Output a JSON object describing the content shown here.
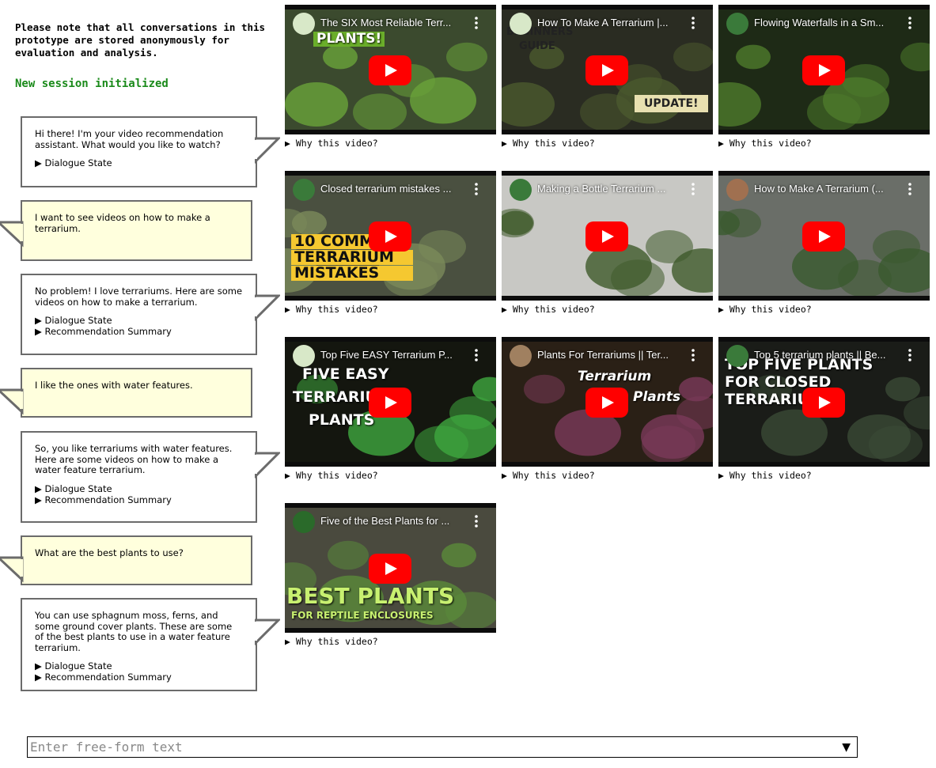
{
  "notice": "Please note that all conversations in this prototype are stored anonymously for evaluation and analysis.",
  "session_status": "New session initialized",
  "messages": [
    {
      "role": "bot",
      "text": "Hi there! I'm your video recommendation assistant. What would you like to watch?",
      "details": [
        "▶ Dialogue State"
      ]
    },
    {
      "role": "user",
      "text": "I want to see videos on how to make a terrarium.",
      "details": []
    },
    {
      "role": "bot",
      "text": "No problem! I love terrariums. Here are some videos on how to make a terrarium.",
      "details": [
        "▶ Dialogue State",
        "▶ Recommendation Summary"
      ]
    },
    {
      "role": "user",
      "text": "I like the ones with water features.",
      "details": []
    },
    {
      "role": "bot",
      "text": "So, you like terrariums with water features. Here are some videos on how to make a water feature terrarium.",
      "details": [
        "▶ Dialogue State",
        "▶ Recommendation Summary"
      ]
    },
    {
      "role": "user",
      "text": "What are the best plants to use?",
      "details": []
    },
    {
      "role": "bot",
      "text": "You can use sphagnum moss, ferns, and some ground cover plants. These are some of the best plants to use in a water feature terrarium.",
      "details": [
        "▶ Dialogue State",
        "▶ Recommendation Summary"
      ]
    }
  ],
  "why_label": "▶ Why this video?",
  "videos": [
    {
      "title": "The SIX Most Reliable Terr...",
      "overlay": [
        "PLANTS!"
      ],
      "bg": "#3b4a2e",
      "accent": "#6aa33a",
      "chan": "#d8e8c8"
    },
    {
      "title": "How To Make A Terrarium |...",
      "overlay": [
        "BEGINNERS",
        "GUIDE",
        "UPDATE!"
      ],
      "bg": "#2a2c22",
      "accent": "#4b5a2e",
      "chan": "#d8e8c8"
    },
    {
      "title": "Flowing Waterfalls in a Sm...",
      "overlay": [],
      "bg": "#1e2a16",
      "accent": "#4d7a2c",
      "chan": "#3a7a3a"
    },
    {
      "title": "Closed terrarium mistakes ...",
      "overlay": [
        "10 COMM",
        "TERRARIUM",
        "MISTAKES"
      ],
      "bg": "#4a5040",
      "accent": "#7a8a5a",
      "chan": "#3a7a3a"
    },
    {
      "title": "Making a Bottle Terrarium ...",
      "overlay": [],
      "bg": "#c8c8c4",
      "accent": "#3e5a2a",
      "chan": "#3a7a3a"
    },
    {
      "title": "How to Make A Terrarium (...",
      "overlay": [],
      "bg": "#6a6e68",
      "accent": "#3a5a2e",
      "chan": "#a07050"
    },
    {
      "title": "Top Five EASY Terrarium P...",
      "overlay": [
        "FIVE EASY",
        "TERRARIUM",
        "PLANTS"
      ],
      "bg": "#14160f",
      "accent": "#3ea83e",
      "chan": "#d8e8c8"
    },
    {
      "title": "Plants For Terrariums || Ter...",
      "overlay": [
        "Terrarium",
        "Plants"
      ],
      "bg": "#2a2016",
      "accent": "#7a3a5a",
      "chan": "#a08060"
    },
    {
      "title": "Top 5 terrarium plants || Be...",
      "overlay": [
        "TOP FIVE PLANTS",
        "FOR CLOSED",
        "TERRARIUMS"
      ],
      "bg": "#1a1c18",
      "accent": "#3a4a36",
      "chan": "#3a7a3a"
    },
    {
      "title": "Five of the Best Plants for ...",
      "overlay": [
        "BEST PLANTS",
        "FOR REPTILE ENCLOSURES"
      ],
      "bg": "#4a4a3e",
      "accent": "#5a8a3a",
      "chan": "#2a6a2a"
    }
  ],
  "input": {
    "placeholder": "Enter free-form text",
    "value": ""
  },
  "dropdown_arrow": "▼",
  "colors": {
    "session_green": "#1a8a1a",
    "user_bubble": "#ffffdd",
    "bubble_border": "#6b6b6b",
    "play_red": "#ff0000"
  }
}
